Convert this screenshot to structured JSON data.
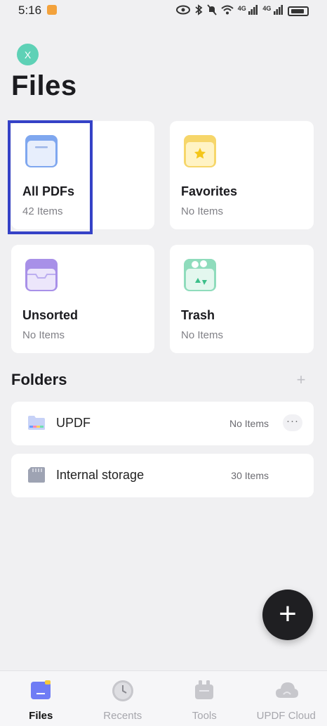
{
  "status": {
    "time": "5:16",
    "network_1": "4G",
    "network_2": "4G"
  },
  "avatar": {
    "initial": "X",
    "color": "#5ed1b6"
  },
  "page": {
    "title": "Files"
  },
  "cards": [
    {
      "title": "All PDFs",
      "subtitle": "42 Items",
      "icon": "all-pdfs-icon"
    },
    {
      "title": "Favorites",
      "subtitle": "No Items",
      "icon": "star-icon"
    },
    {
      "title": "Unsorted",
      "subtitle": "No Items",
      "icon": "tray-icon"
    },
    {
      "title": "Trash",
      "subtitle": "No Items",
      "icon": "recycle-icon"
    }
  ],
  "folders": {
    "title": "Folders",
    "items": [
      {
        "name": "UPDF",
        "count": "No Items",
        "icon": "folder-icon"
      },
      {
        "name": "Internal storage",
        "count": "30 Items",
        "icon": "sd-card-icon"
      }
    ]
  },
  "fab": {
    "icon": "plus-icon"
  },
  "bottom_nav": [
    {
      "label": "Files",
      "active": true
    },
    {
      "label": "Recents",
      "active": false
    },
    {
      "label": "Tools",
      "active": false
    },
    {
      "label": "UPDF Cloud",
      "active": false
    }
  ],
  "colors": {
    "accent": "#3542c7",
    "highlight_border": "#3542c7",
    "background": "#f0f0f2"
  }
}
